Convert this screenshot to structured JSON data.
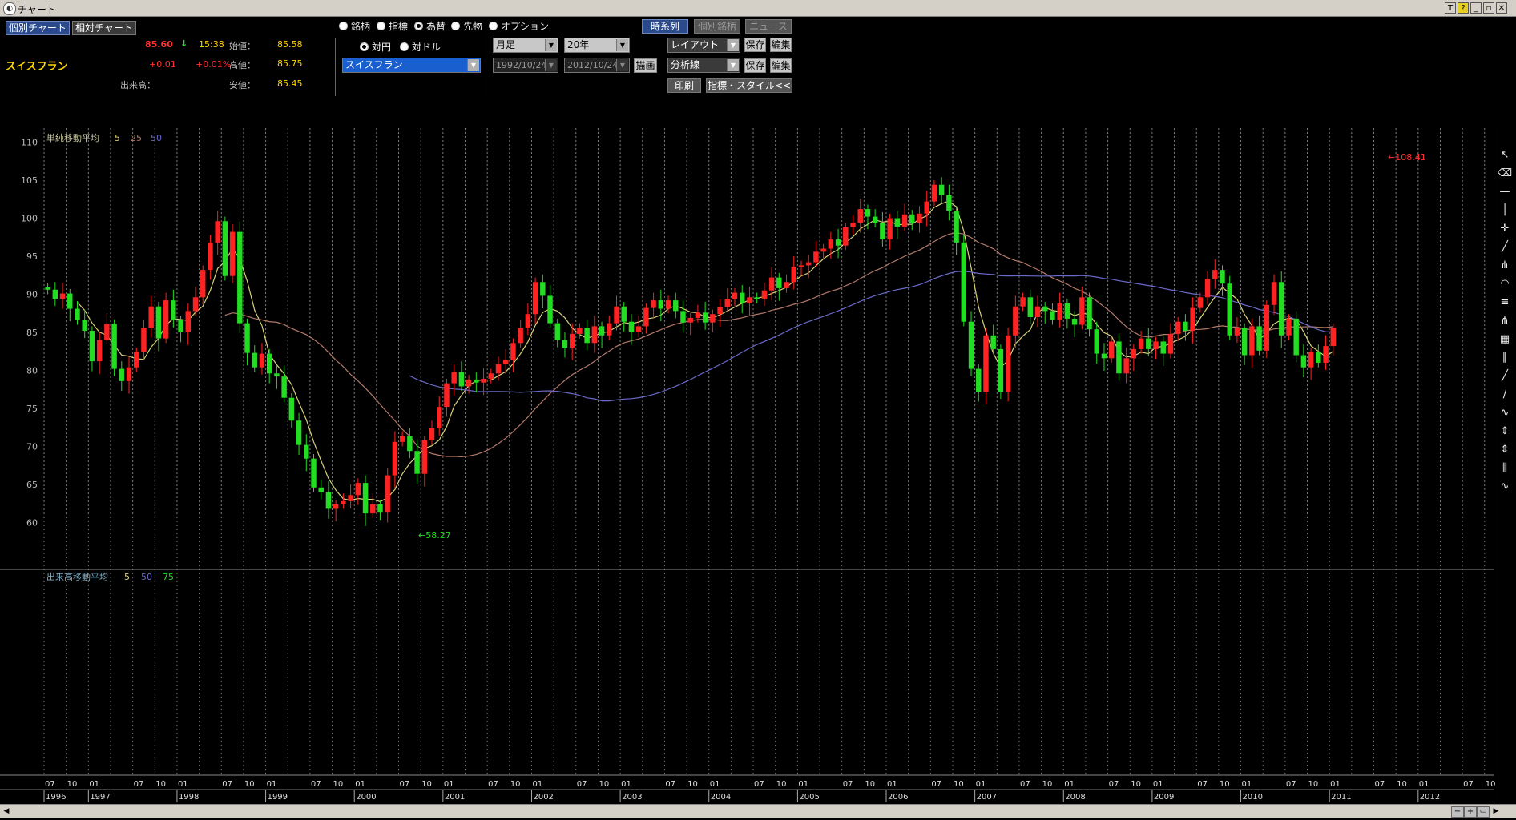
{
  "window": {
    "title": "チャート"
  },
  "tabs": {
    "individual": "個別チャート",
    "relative": "相対チャート"
  },
  "quote": {
    "name": "スイスフラン",
    "price": "85.60",
    "arrow": "↓",
    "time": "15:38",
    "change": "+0.01",
    "change_pct": "+0.01%",
    "open_label": "始値：",
    "open": "85.58",
    "high_label": "高値：",
    "high": "85.75",
    "low_label": "安値：",
    "low": "85.45",
    "volume_label": "出来高："
  },
  "category_radios": [
    {
      "label": "銘柄",
      "selected": false
    },
    {
      "label": "指標",
      "selected": false
    },
    {
      "label": "為替",
      "selected": true
    },
    {
      "label": "先物",
      "selected": false
    },
    {
      "label": "オプション",
      "selected": false
    }
  ],
  "base_radios": [
    {
      "label": "対円",
      "selected": true
    },
    {
      "label": "対ドル",
      "selected": false
    }
  ],
  "currency_select": "スイスフラン",
  "period_select": "月足",
  "range_select": "20年",
  "date_from": "1992/10/24",
  "date_to": "2012/10/24",
  "draw_button": "描画",
  "top_buttons": {
    "timeseries": "時系列",
    "individual_stock": "個別銘柄",
    "news": "ニュース"
  },
  "layout_select": "レイアウト",
  "analysis_select": "分析線",
  "save_label": "保存",
  "edit_label": "編集",
  "print_label": "印刷",
  "style_label": "指標・スタイル<<",
  "main_legend": {
    "label": "単純移動平均",
    "p1": "5",
    "p2": "25",
    "p3": "50"
  },
  "volume_legend": {
    "label": "出来高移動平均",
    "p1": "5",
    "p2": "50",
    "p3": "75"
  },
  "annotations": {
    "max": "108.41",
    "min": "58.27"
  },
  "toolbar_icons": [
    "cursor-icon",
    "eraser-icon",
    "horizontal-line-icon",
    "vertical-line-icon",
    "crosshair-icon",
    "trendline-icon",
    "fibonacci-fan-icon",
    "fibonacci-arc-icon",
    "fibonacci-retracement-icon",
    "gann-fan-icon",
    "gann-grid-icon",
    "channel-icon",
    "trendline-2-icon",
    "fibonacci-g-icon",
    "polyline-icon",
    "range-icon",
    "range-2-icon",
    "period-icon",
    "wave-icon"
  ],
  "toolbar_glyphs": [
    "↖",
    "⌫",
    "—",
    "│",
    "✛",
    "╱",
    "⋔",
    "◠",
    "≡",
    "⋔",
    "▦",
    "∥",
    "╱",
    "∕",
    "∿",
    "⇕",
    "⇕",
    "⫼",
    "∿"
  ],
  "colors": {
    "up": "#ff2222",
    "down": "#22dd22",
    "ma5": "#d8d27a",
    "ma25": "#b47a6a",
    "ma50": "#6a6ac8",
    "grid": "#9a9a9a"
  },
  "chart_data": {
    "type": "candlestick",
    "period": "monthly",
    "xlabel": "",
    "ylabel": "",
    "ylim": [
      55,
      111
    ],
    "yticks": [
      60,
      65,
      70,
      75,
      80,
      85,
      90,
      95,
      100,
      105,
      110
    ],
    "years": [
      "1996",
      "1997",
      "1998",
      "1999",
      "2000",
      "2001",
      "2002",
      "2003",
      "2004",
      "2005",
      "2006",
      "2007",
      "2008",
      "2009",
      "2010",
      "2011",
      "2012"
    ],
    "x_start": "1996-07",
    "month_labels_shown": [
      "07",
      "10",
      "01"
    ],
    "closes": [
      90.6,
      89.4,
      90.1,
      88.1,
      86.6,
      85.2,
      81.2,
      84.0,
      86.1,
      80.2,
      78.6,
      80.4,
      82.4,
      85.6,
      88.4,
      84.2,
      89.2,
      86.6,
      85.0,
      87.8,
      89.6,
      93.2,
      96.8,
      99.6,
      92.4,
      98.2,
      86.2,
      82.3,
      80.4,
      82.2,
      79.6,
      79.2,
      76.4,
      73.4,
      70.2,
      68.4,
      64.6,
      64.0,
      61.8,
      62.4,
      62.8,
      63.6,
      65.2,
      61.2,
      62.4,
      61.3,
      66.2,
      70.6,
      71.4,
      69.4,
      66.4,
      70.8,
      72.4,
      75.2,
      78.3,
      79.8,
      77.9,
      78.8,
      78.4,
      78.9,
      79.6,
      80.8,
      81.4,
      83.6,
      85.6,
      87.4,
      91.6,
      89.8,
      86.2,
      84.0,
      83.0,
      84.8,
      85.6,
      83.6,
      85.8,
      84.6,
      86.2,
      88.4,
      86.4,
      85.0,
      85.8,
      88.2,
      89.2,
      88.1,
      89.2,
      87.8,
      86.3,
      86.9,
      87.6,
      86.3,
      87.4,
      88.3,
      89.4,
      90.2,
      88.8,
      89.6,
      89.4,
      90.5,
      92.2,
      90.8,
      91.6,
      93.6,
      93.8,
      94.2,
      95.6,
      96.0,
      97.2,
      96.4,
      98.8,
      99.4,
      101.2,
      100.2,
      99.4,
      97.2,
      100.0,
      98.9,
      100.5,
      99.4,
      100.6,
      102.2,
      104.4,
      103.0,
      101.0,
      96.8,
      86.4,
      80.2,
      77.2,
      84.6,
      82.8,
      77.2,
      84.6,
      88.4,
      89.6,
      87.0,
      88.4,
      87.8,
      86.6,
      88.8,
      86.8,
      86.0,
      89.6,
      85.4,
      82.2,
      81.6,
      83.8,
      79.6,
      81.6,
      82.8,
      84.2,
      82.8,
      83.8,
      82.2,
      84.8,
      86.4,
      85.2,
      88.2,
      89.6,
      92.0,
      93.2,
      91.4,
      84.6,
      85.6,
      82.0,
      85.8,
      82.6,
      88.6,
      91.6,
      84.6,
      86.8,
      82.0,
      80.4,
      82.4,
      81.0,
      83.2,
      85.6
    ],
    "opens_note": "open = previous close",
    "ma_series": [
      "ma5",
      "ma25",
      "ma50"
    ]
  }
}
